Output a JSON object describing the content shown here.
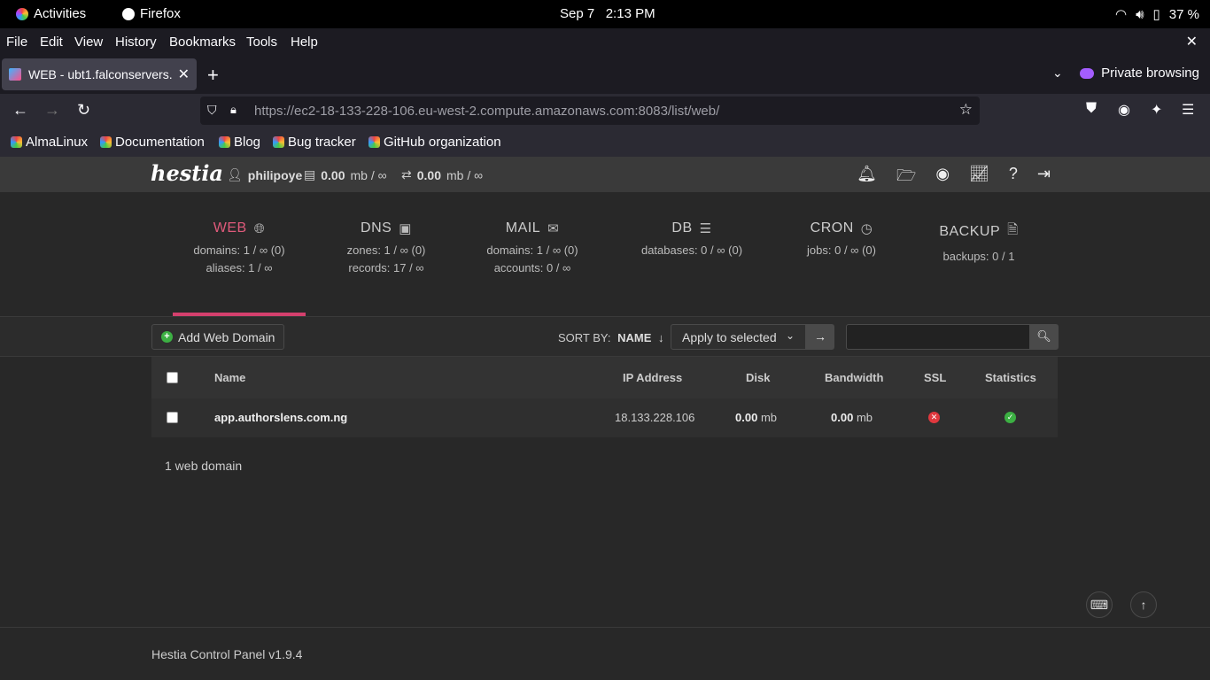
{
  "system": {
    "activities": "Activities",
    "app_name": "Firefox",
    "date": "Sep 7",
    "time": "2:13 PM",
    "battery": "37 %"
  },
  "menubar": {
    "items": [
      "File",
      "Edit",
      "View",
      "History",
      "Bookmarks",
      "Tools",
      "Help"
    ]
  },
  "browser": {
    "tab_title": "WEB - ubt1.falconservers.",
    "private_label": "Private browsing",
    "url_main": "https://ec2-18-133-228-106.eu-west-2.compute.amazonaws.com",
    "url_rest": ":8083/list/web/"
  },
  "bookmarks": [
    "AlmaLinux",
    "Documentation",
    "Blog",
    "Bug tracker",
    "GitHub organization"
  ],
  "hestia": {
    "logo": "hestia",
    "user": "philipoye",
    "disk_value": "0.00",
    "disk_unit": "mb / ∞",
    "bw_value": "0.00",
    "bw_unit": "mb / ∞",
    "stats": [
      {
        "title": "WEB",
        "line1": "domains: 1 / ∞ (0)",
        "line2": "aliases: 1 / ∞"
      },
      {
        "title": "DNS",
        "line1": "zones: 1 / ∞ (0)",
        "line2": "records: 17 / ∞"
      },
      {
        "title": "MAIL",
        "line1": "domains: 1 / ∞ (0)",
        "line2": "accounts: 0 / ∞"
      },
      {
        "title": "DB",
        "line1": "databases: 0 / ∞ (0)",
        "line2": ""
      },
      {
        "title": "CRON",
        "line1": "jobs: 0 / ∞ (0)",
        "line2": ""
      },
      {
        "title": "BACKUP",
        "line1": "backups: 0 / 1",
        "line2": ""
      }
    ],
    "toolbar": {
      "add_label": "Add Web Domain",
      "sort_label": "SORT BY:",
      "sort_value": "NAME",
      "apply_label": "Apply to selected",
      "search_placeholder": ""
    },
    "table": {
      "headers": {
        "name": "Name",
        "ip": "IP Address",
        "disk": "Disk",
        "bandwidth": "Bandwidth",
        "ssl": "SSL",
        "statistics": "Statistics"
      },
      "rows": [
        {
          "name": "app.authorslens.com.ng",
          "ip": "18.133.228.106",
          "disk": "0.00",
          "disk_unit": "mb",
          "bandwidth": "0.00",
          "bw_unit": "mb",
          "ssl": false,
          "statistics": true
        }
      ]
    },
    "count_label": "1 web domain",
    "footer": "Hestia Control Panel v1.9.4"
  }
}
